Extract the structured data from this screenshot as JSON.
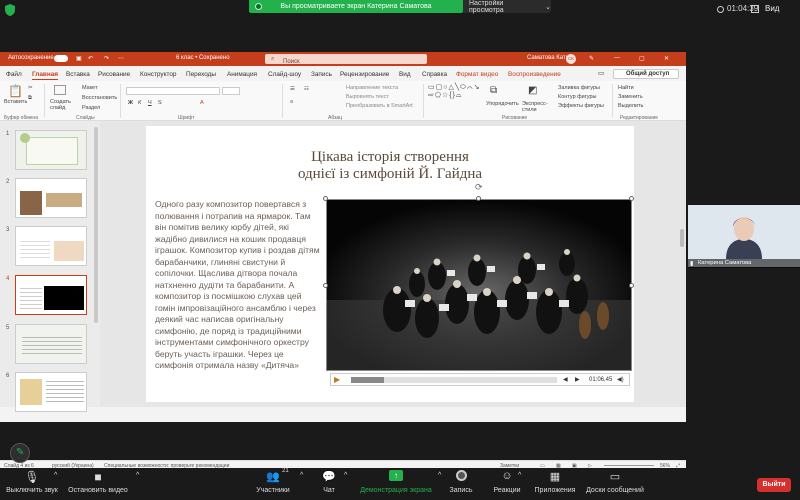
{
  "zoom": {
    "share_banner": "Вы просматриваете экран Катерина Саматова",
    "view_settings": "Настройки просмотра",
    "time": "01:04:39",
    "view": "Вид",
    "participant_name": "Катерина Саматова",
    "participants_count": "21",
    "leave_label": "Выйти",
    "toolbar": [
      {
        "label": "Выключить звук",
        "icon": "microphone-icon"
      },
      {
        "label": "Остановить видео",
        "icon": "video-camera-icon"
      },
      {
        "label": "Участники",
        "icon": "participants-icon"
      },
      {
        "label": "Чат",
        "icon": "chat-icon"
      },
      {
        "label": "Демонстрация экрана",
        "icon": "share-screen-icon"
      },
      {
        "label": "Запись",
        "icon": "record-icon"
      },
      {
        "label": "Реакции",
        "icon": "reactions-icon"
      },
      {
        "label": "Приложения",
        "icon": "apps-icon"
      },
      {
        "label": "Доски сообщений",
        "icon": "whiteboard-icon"
      }
    ],
    "accent": "#22b14c"
  },
  "ppt": {
    "autosave": "Автосохранение",
    "filename": "6 клас • Сохранено",
    "search_placeholder": "Поиск",
    "user": "Саматова Катя",
    "user_initials": "СК",
    "share_button": "Общий доступ",
    "tabs": [
      "Файл",
      "Главная",
      "Вставка",
      "Рисование",
      "Конструктор",
      "Переходы",
      "Анимация",
      "Слайд-шоу",
      "Запись",
      "Рецензирование",
      "Вид",
      "Справка",
      "Формат видео",
      "Воспроизведение"
    ],
    "ribbon": {
      "paste": "Вставить",
      "create_slide": "Создать слайд",
      "layout": "Макет",
      "reset": "Восстановить",
      "section": "Раздел",
      "clipboard": "Буфер обмена",
      "slides": "Слайды",
      "font": "Шрифт",
      "paragraph": "Абзац",
      "text_direction": "Направление текста",
      "align_text": "Выровнять текст",
      "convert_smartart": "Преобразовать в SmartArt",
      "arrange": "Упорядочить",
      "quick_styles": "Экспресс-стили",
      "shape_fill": "Заливка фигуры",
      "shape_outline": "Контур фигуры",
      "shape_effects": "Эффекты фигуры",
      "drawing": "Рисование",
      "find": "Найти",
      "replace": "Заменить",
      "select": "Выделить",
      "editing": "Редактирование"
    },
    "slide_numbers": [
      "1",
      "2",
      "3",
      "4",
      "5",
      "6"
    ],
    "slide": {
      "title_line1": "Цікава історія створення",
      "title_line2": "однієї із симфоній Й. Гайдна",
      "body": "Одного разу композитор повертався з полювання і потрапив на ярмарок. Там він помітив велику юрбу дітей, які жадібно дивилися на кошик продавця іграшок. Композитор купив і роздав дітям барабанчики, глиняні свистуни й сопілочки. Щаслива дітвора почала натхненно дудіти та барабанити. А композитор із посмішкою слухав цей гомін імпровізаційного ансамблю і через деякий час написав оригінальну симфонію, де поряд із традиційними інструментами симфонічного оркестру беруть участь іграшки. Через це симфонія отримала назву «Дитяча»"
    },
    "video": {
      "time": "01:06,45",
      "progress": 0.16
    },
    "status": {
      "slide_info": "Слайд 4 из 6",
      "language": "русский (Украина)",
      "accessibility": "Специальные возможности: проверьте рекомендации",
      "notes": "Заметки",
      "zoom": "56%"
    }
  }
}
